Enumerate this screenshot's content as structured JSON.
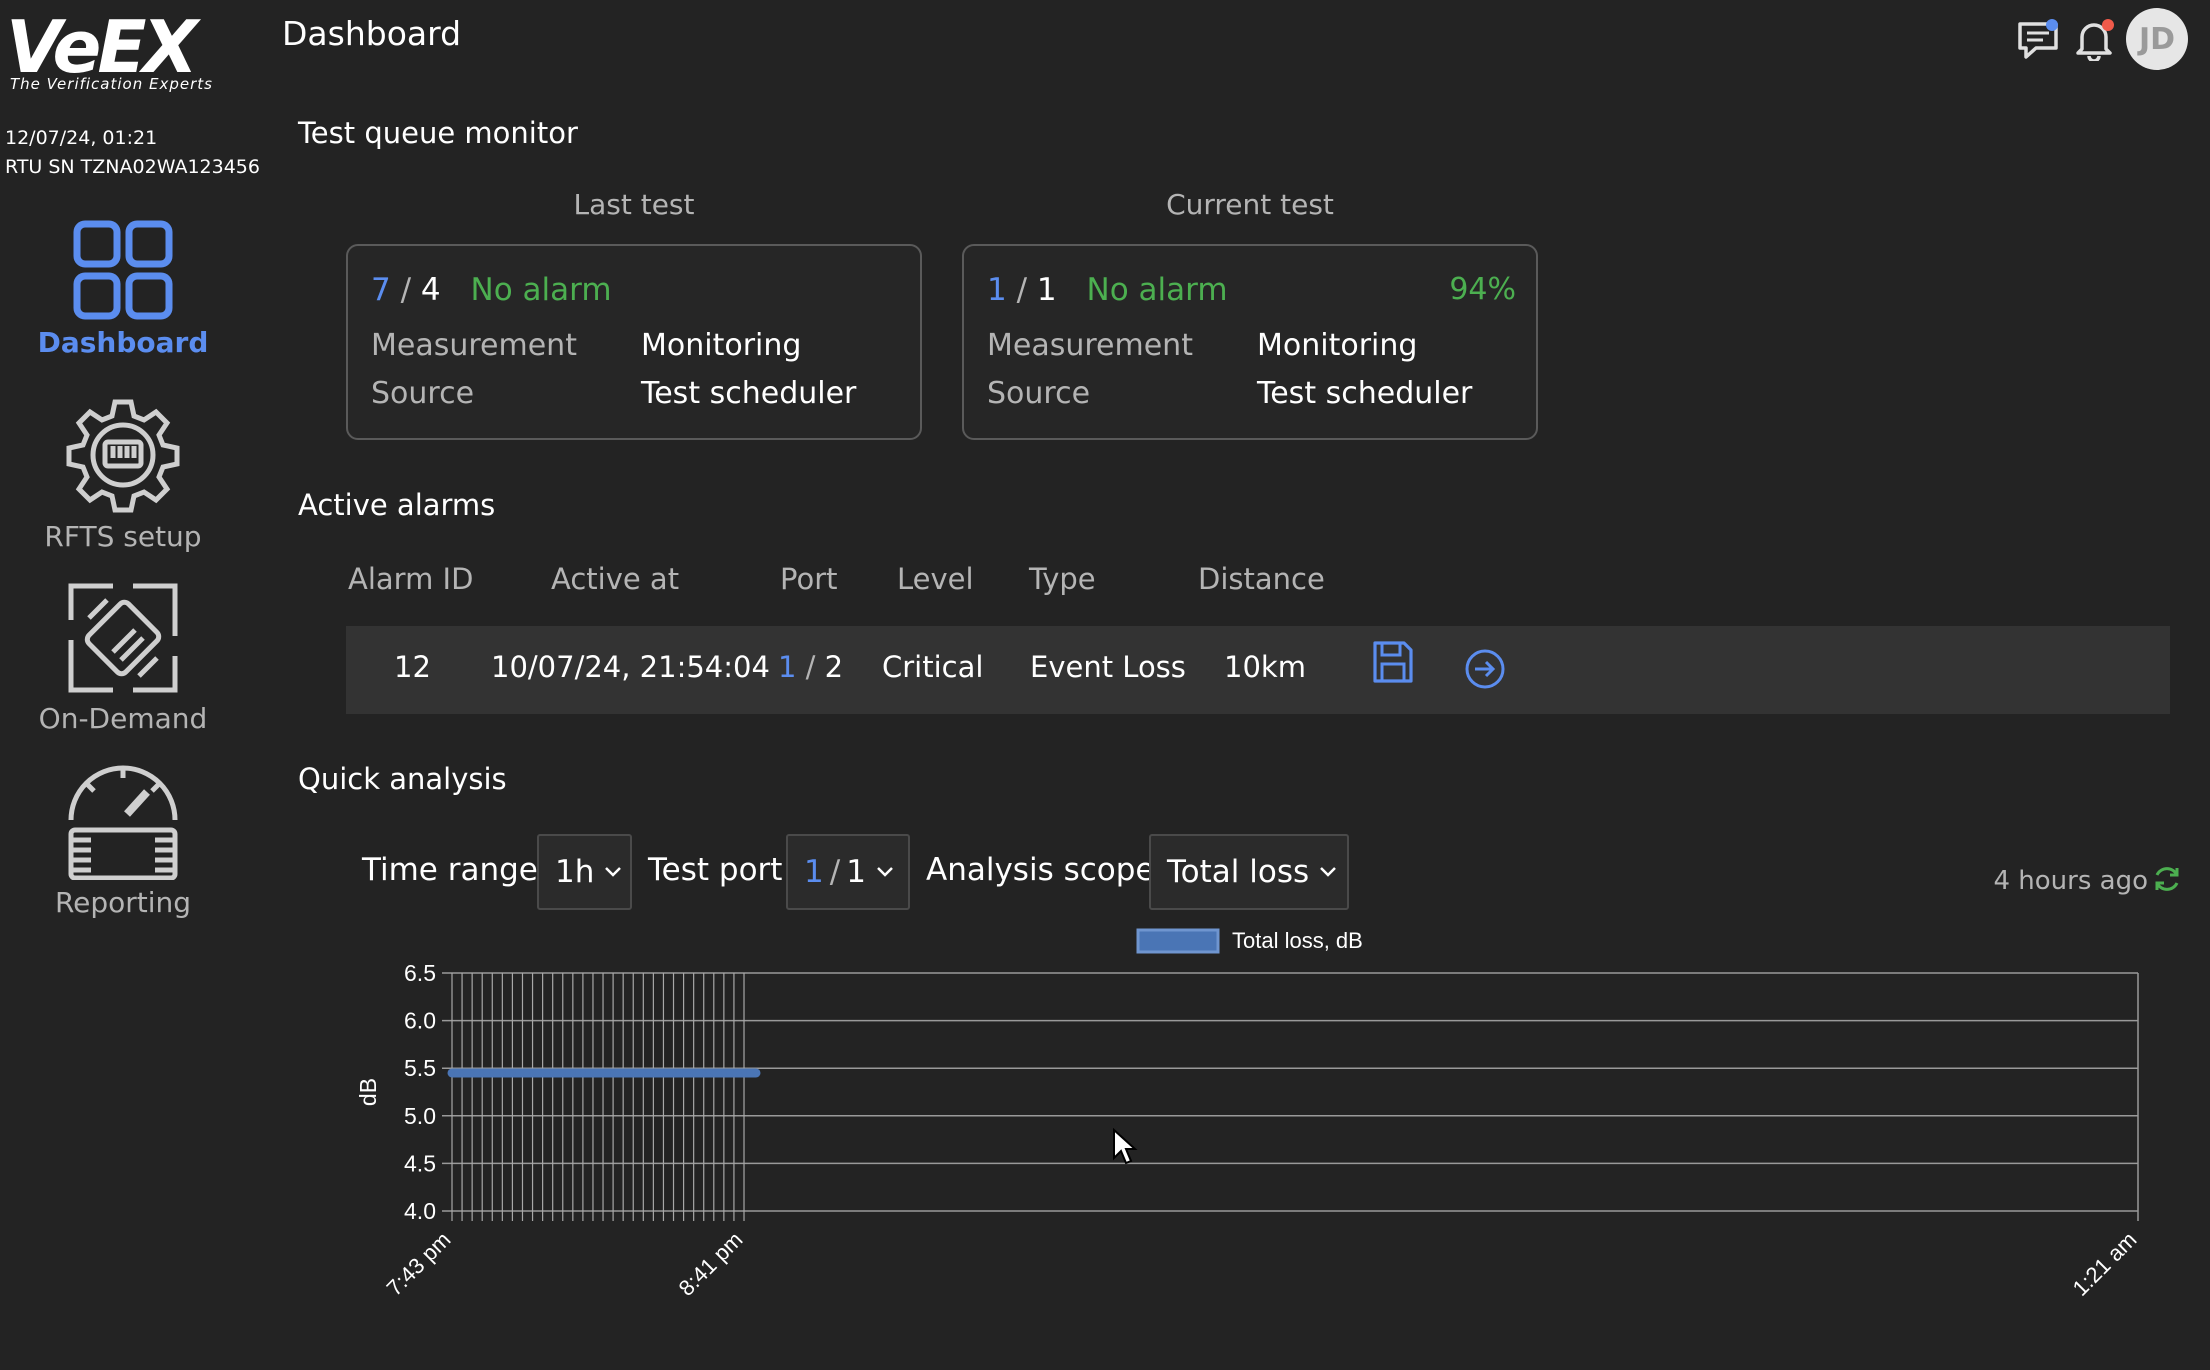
{
  "brand": {
    "logo_text": "VeEX",
    "tagline": "The Verification Experts"
  },
  "system": {
    "datetime": "12/07/24, 01:21",
    "rtu_sn": "RTU SN TZNA02WA123456"
  },
  "nav": [
    {
      "label": "Dashboard",
      "icon": "dashboard-grid-icon",
      "active": true
    },
    {
      "label": "RFTS setup",
      "icon": "rfts-gear-icon",
      "active": false
    },
    {
      "label": "On-Demand",
      "icon": "on-demand-connector-icon",
      "active": false
    },
    {
      "label": "Reporting",
      "icon": "reporting-gauge-icon",
      "active": false
    }
  ],
  "header": {
    "title": "Dashboard",
    "user_initials": "JD"
  },
  "queue": {
    "title": "Test queue monitor",
    "last": {
      "heading": "Last test",
      "id_a": "7",
      "sep": "/",
      "id_b": "4",
      "status": "No alarm",
      "measurement_label": "Measurement",
      "measurement": "Monitoring",
      "source_label": "Source",
      "source": "Test scheduler"
    },
    "current": {
      "heading": "Current test",
      "id_a": "1",
      "sep": "/",
      "id_b": "1",
      "status": "No alarm",
      "progress": "94%",
      "measurement_label": "Measurement",
      "measurement": "Monitoring",
      "source_label": "Source",
      "source": "Test scheduler"
    }
  },
  "alarms": {
    "title": "Active alarms",
    "columns": [
      "Alarm ID",
      "Active at",
      "Port",
      "Level",
      "Type",
      "Distance"
    ],
    "rows": [
      {
        "id": "12",
        "active_at": "10/07/24, 21:54:04",
        "port_a": "1",
        "port_sep": "/",
        "port_b": "2",
        "level": "Critical",
        "type": "Event Loss",
        "distance": "10km"
      }
    ]
  },
  "quick": {
    "title": "Quick analysis",
    "time_range_label": "Time range",
    "time_range": "1h",
    "test_port_label": "Test port",
    "test_port_a": "1",
    "test_port_sep": "/",
    "test_port_b": "1",
    "scope_label": "Analysis scope",
    "scope": "Total loss",
    "updated": "4 hours ago"
  },
  "colors": {
    "accent": "#5b8def",
    "ok": "#4caf50",
    "critical": "#f05a4a",
    "background": "#232323"
  },
  "chart_data": {
    "type": "line",
    "title": "",
    "legend": [
      "Total loss, dB"
    ],
    "legend_position": "top-center",
    "ylabel": "dB",
    "ylim": [
      4.0,
      6.5
    ],
    "yticks": [
      "6.5",
      "6.0",
      "5.5",
      "5.0",
      "4.5",
      "4.0"
    ],
    "grid": true,
    "series": [
      {
        "name": "Total loss, dB",
        "color": "#4a75b5",
        "values": [
          5.45,
          5.45,
          5.45,
          5.45,
          5.45,
          5.45,
          5.45,
          5.45,
          5.45,
          5.45,
          5.45,
          5.45,
          5.45,
          5.45,
          5.45,
          5.45,
          5.45,
          5.45,
          5.45,
          5.45,
          5.45,
          5.45,
          5.45,
          5.45,
          5.45,
          5.45,
          5.45,
          5.45,
          5.45,
          5.45
        ]
      }
    ],
    "x_first_label": "7:43 pm",
    "x_cluster_last_label": "8:41 pm",
    "x_last_label": "1:21 am"
  }
}
